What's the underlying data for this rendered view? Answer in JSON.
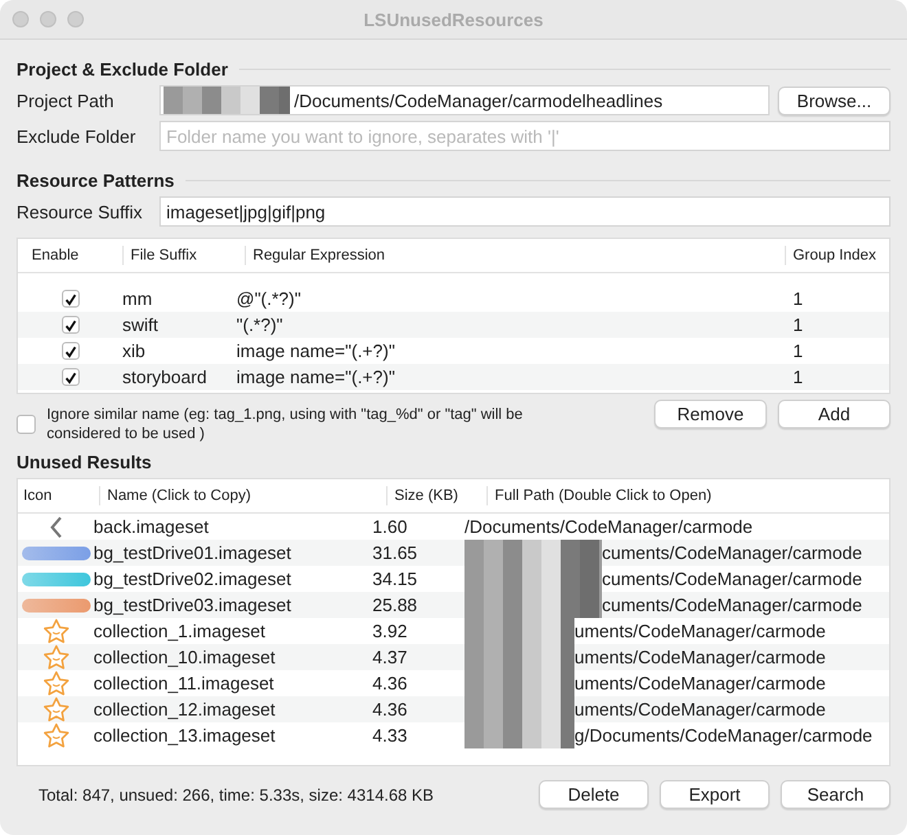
{
  "window": {
    "title": "LSUnusedResources"
  },
  "project_section": {
    "title": "Project & Exclude Folder",
    "project_path": {
      "label": "Project Path",
      "value": "/Documents/CodeManager/carmodelheadlines"
    },
    "browse_button": "Browse...",
    "exclude_folder": {
      "label": "Exclude Folder",
      "placeholder": "Folder name you want to ignore, separates with '|'"
    }
  },
  "patterns_section": {
    "title": "Resource Patterns",
    "resource_suffix": {
      "label": "Resource Suffix",
      "value": "imageset|jpg|gif|png"
    },
    "table": {
      "columns": [
        "Enable",
        "File Suffix",
        "Regular Expression",
        "Group Index"
      ],
      "rows": [
        {
          "checked": true,
          "suffix": "mm",
          "regex": "@\"(.*?)\"",
          "group": "1"
        },
        {
          "checked": true,
          "suffix": "swift",
          "regex": "\"(.*?)\"",
          "group": "1"
        },
        {
          "checked": true,
          "suffix": "xib",
          "regex": "image name=\"(.+?)\"",
          "group": "1"
        },
        {
          "checked": true,
          "suffix": "storyboard",
          "regex": "image name=\"(.+?)\"",
          "group": "1"
        }
      ]
    },
    "ignore_similar": {
      "checked": false,
      "label": "Ignore similar name (eg: tag_1.png, using with \"tag_%d\" or \"tag\" will be considered to be used )"
    },
    "buttons": [
      "Remove",
      "Add"
    ]
  },
  "results_section": {
    "title": "Unused Results",
    "table": {
      "columns": [
        "Icon",
        "Name (Click to Copy)",
        "Size (KB)",
        "Full Path (Double Click to Open)"
      ],
      "rows": [
        {
          "kind": "chevron",
          "name": "back.imageset",
          "size": "1.60",
          "path": "/Documents/CodeManager/carmode"
        },
        {
          "kind": "pill",
          "color": "#7b9fe6",
          "name": "bg_testDrive01.imageset",
          "size": "31.65",
          "path": "cuments/CodeManager/carmode"
        },
        {
          "kind": "pill",
          "color": "#3ec6dc",
          "name": "bg_testDrive02.imageset",
          "size": "34.15",
          "path": "cuments/CodeManager/carmode"
        },
        {
          "kind": "pill",
          "color": "#eb9a6e",
          "name": "bg_testDrive03.imageset",
          "size": "25.88",
          "path": "cuments/CodeManager/carmode"
        },
        {
          "kind": "star",
          "name": "collection_1.imageset",
          "size": "3.92",
          "path": "uments/CodeManager/carmode"
        },
        {
          "kind": "star",
          "name": "collection_10.imageset",
          "size": "4.37",
          "path": "uments/CodeManager/carmode"
        },
        {
          "kind": "star",
          "name": "collection_11.imageset",
          "size": "4.36",
          "path": "uments/CodeManager/carmode"
        },
        {
          "kind": "star",
          "name": "collection_12.imageset",
          "size": "4.36",
          "path": "uments/CodeManager/carmode"
        },
        {
          "kind": "star",
          "name": "collection_13.imageset",
          "size": "4.33",
          "path": "g/Documents/CodeManager/carmode"
        }
      ]
    },
    "summary": "Total: 847, unsued: 266, time: 5.33s, size: 4314.68 KB",
    "buttons": [
      "Delete",
      "Export",
      "Search"
    ]
  }
}
